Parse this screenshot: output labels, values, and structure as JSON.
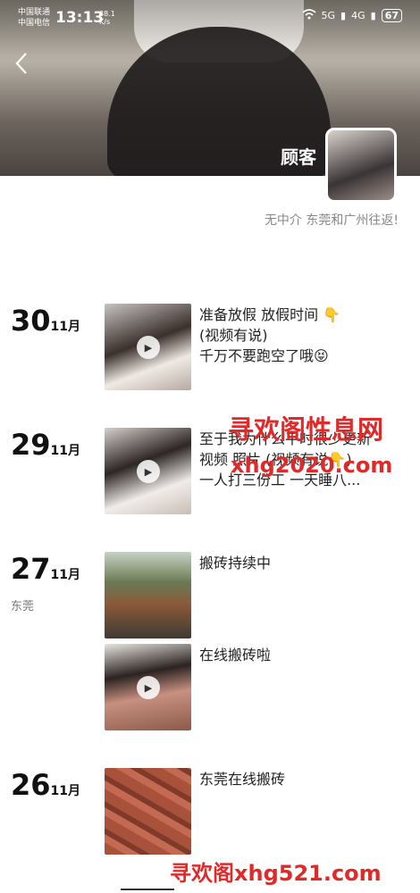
{
  "status": {
    "carrier1": "中国联通",
    "carrier2": "中国电信",
    "time": "13:13",
    "speed_value": "38.1",
    "speed_unit": "K/s",
    "signal1": "5G",
    "signal2": "4G",
    "battery": "67"
  },
  "profile": {
    "name": "顾客",
    "bio": "无中介 东莞和广州往返!"
  },
  "posts": [
    {
      "day": "30",
      "month": "11月",
      "location": "",
      "caption_lines": [
        "准备放假 放假时间 👇",
        "(视频有说)",
        "千万不要跑空了哦😝"
      ],
      "is_video": true
    },
    {
      "day": "29",
      "month": "11月",
      "location": "",
      "caption_lines": [
        "至于我为什么平时很少更新",
        "视频 照片        (视频有说👇)",
        "一人打三份工 一天睡八..."
      ],
      "is_video": true
    },
    {
      "day": "27",
      "month": "11月",
      "location": "东莞",
      "caption_lines": [
        "搬砖持续中"
      ],
      "is_video": false
    },
    {
      "day": "",
      "month": "",
      "location": "",
      "caption_lines": [
        "在线搬砖啦"
      ],
      "is_video": true
    },
    {
      "day": "26",
      "month": "11月",
      "location": "",
      "caption_lines": [
        "东莞在线搬砖"
      ],
      "is_video": false
    }
  ],
  "watermarks": {
    "wm1": "寻欢阁性息网",
    "wm2": "xhg2020.com",
    "wm3": "寻欢阁xhg521.com"
  },
  "colors": {
    "watermark": "#e02a2a",
    "bio": "#888888"
  },
  "icons": {
    "back": "chevron-left-icon",
    "play": "play-icon",
    "wifi": "wifi-icon"
  }
}
